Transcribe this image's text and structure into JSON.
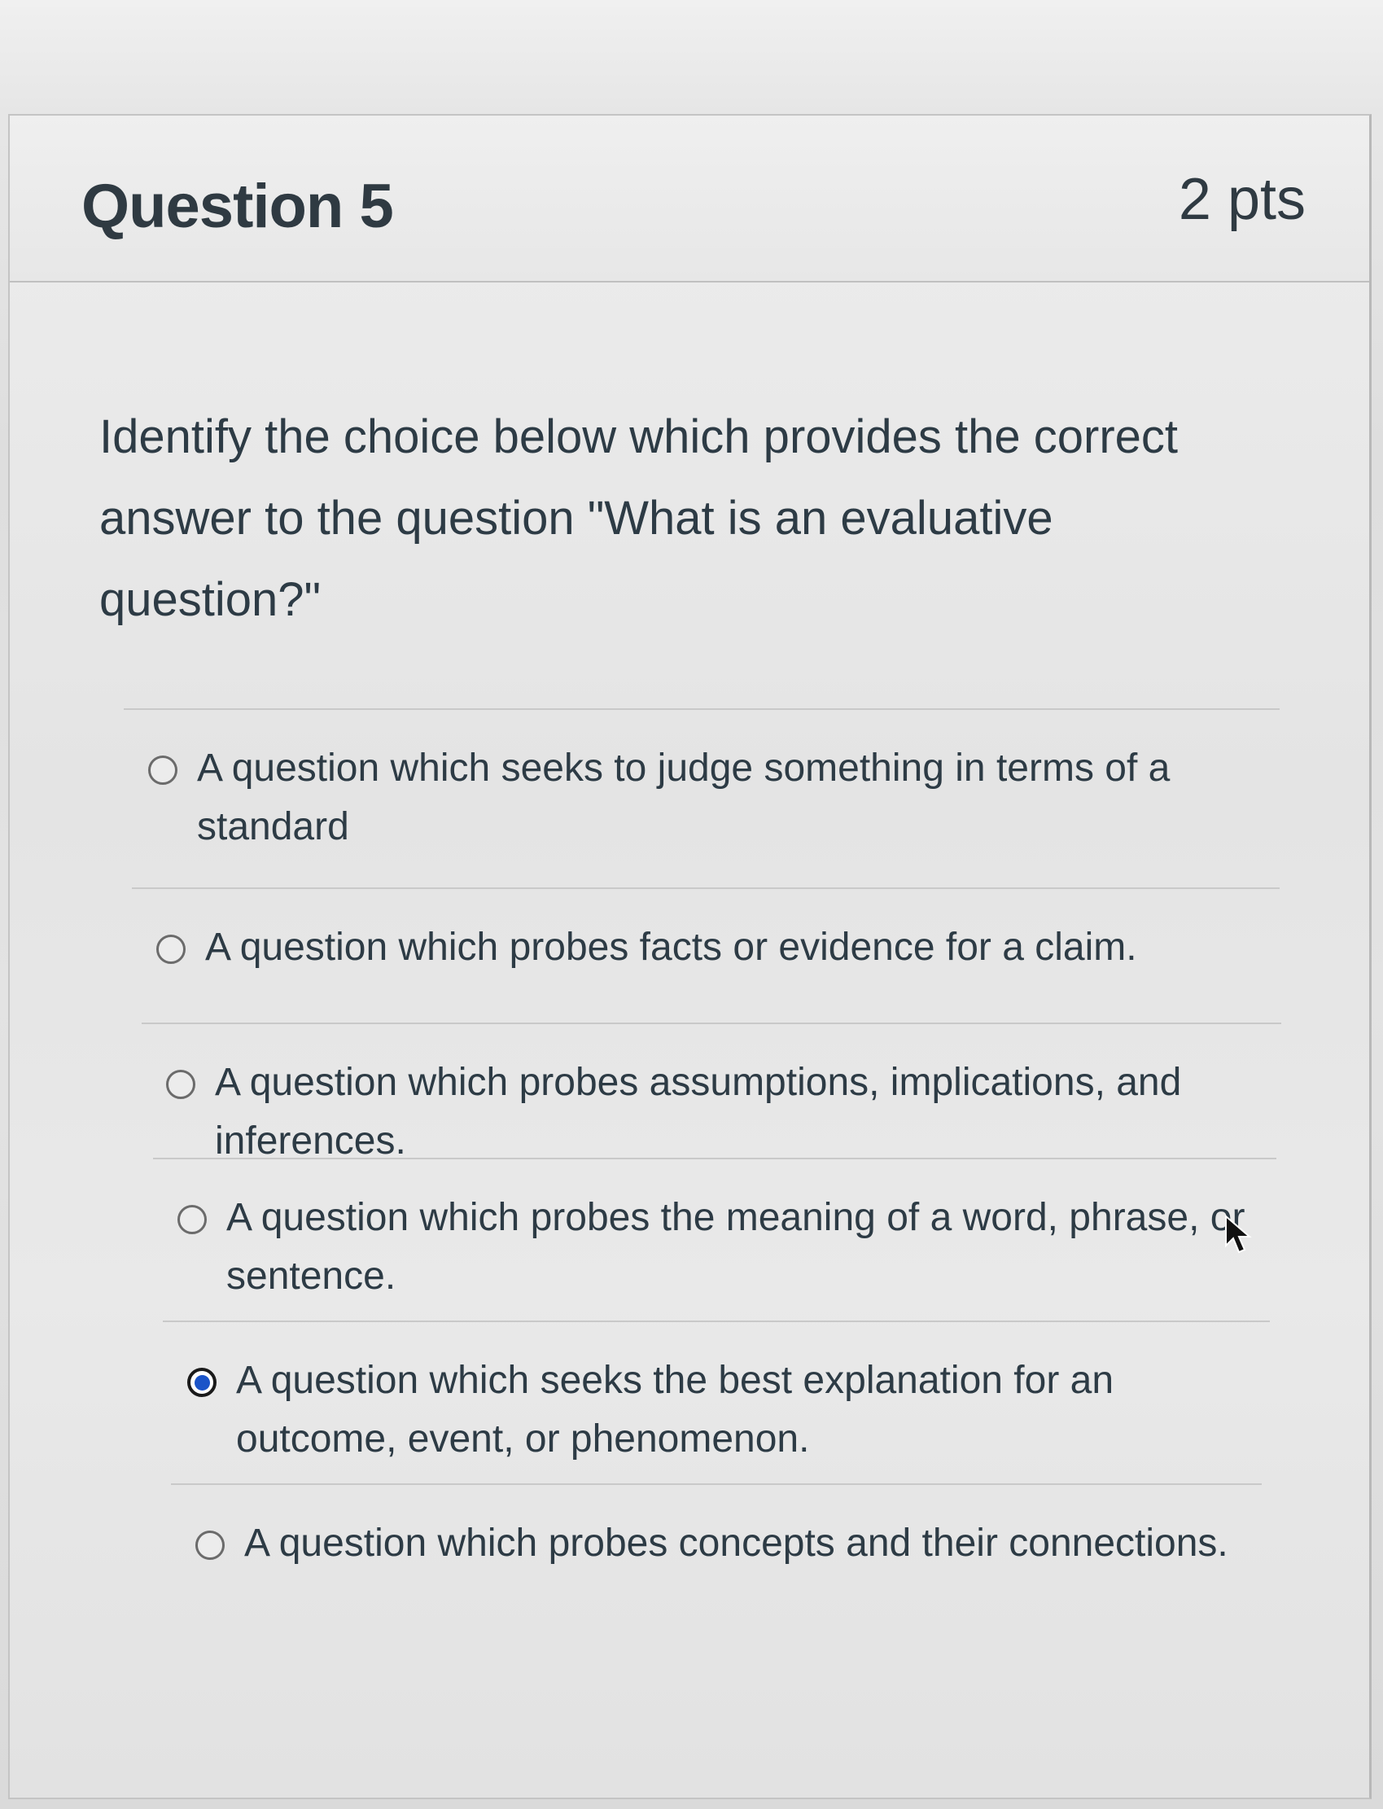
{
  "question": {
    "title": "Question 5",
    "points": "2 pts",
    "text": "Identify the choice below which provides the correct answer to the question \"What is an evaluative question?\""
  },
  "answers": [
    {
      "label": "A question which seeks to judge something in terms of a standard",
      "selected": false
    },
    {
      "label": "A question which probes facts or evidence for a claim.",
      "selected": false
    },
    {
      "label": "A question which probes assumptions, implications, and inferences.",
      "selected": false
    },
    {
      "label": "A question which probes the meaning of a word, phrase, or sentence.",
      "selected": false
    },
    {
      "label": "A question which seeks the best explanation for an outcome, event, or phenomenon.",
      "selected": true
    },
    {
      "label": "A question which probes concepts and their connections.",
      "selected": false
    }
  ],
  "colors": {
    "selected_radio": "#1b54c8",
    "text": "#2d3b45"
  },
  "icons": {
    "cursor": "mouse-pointer-icon"
  }
}
